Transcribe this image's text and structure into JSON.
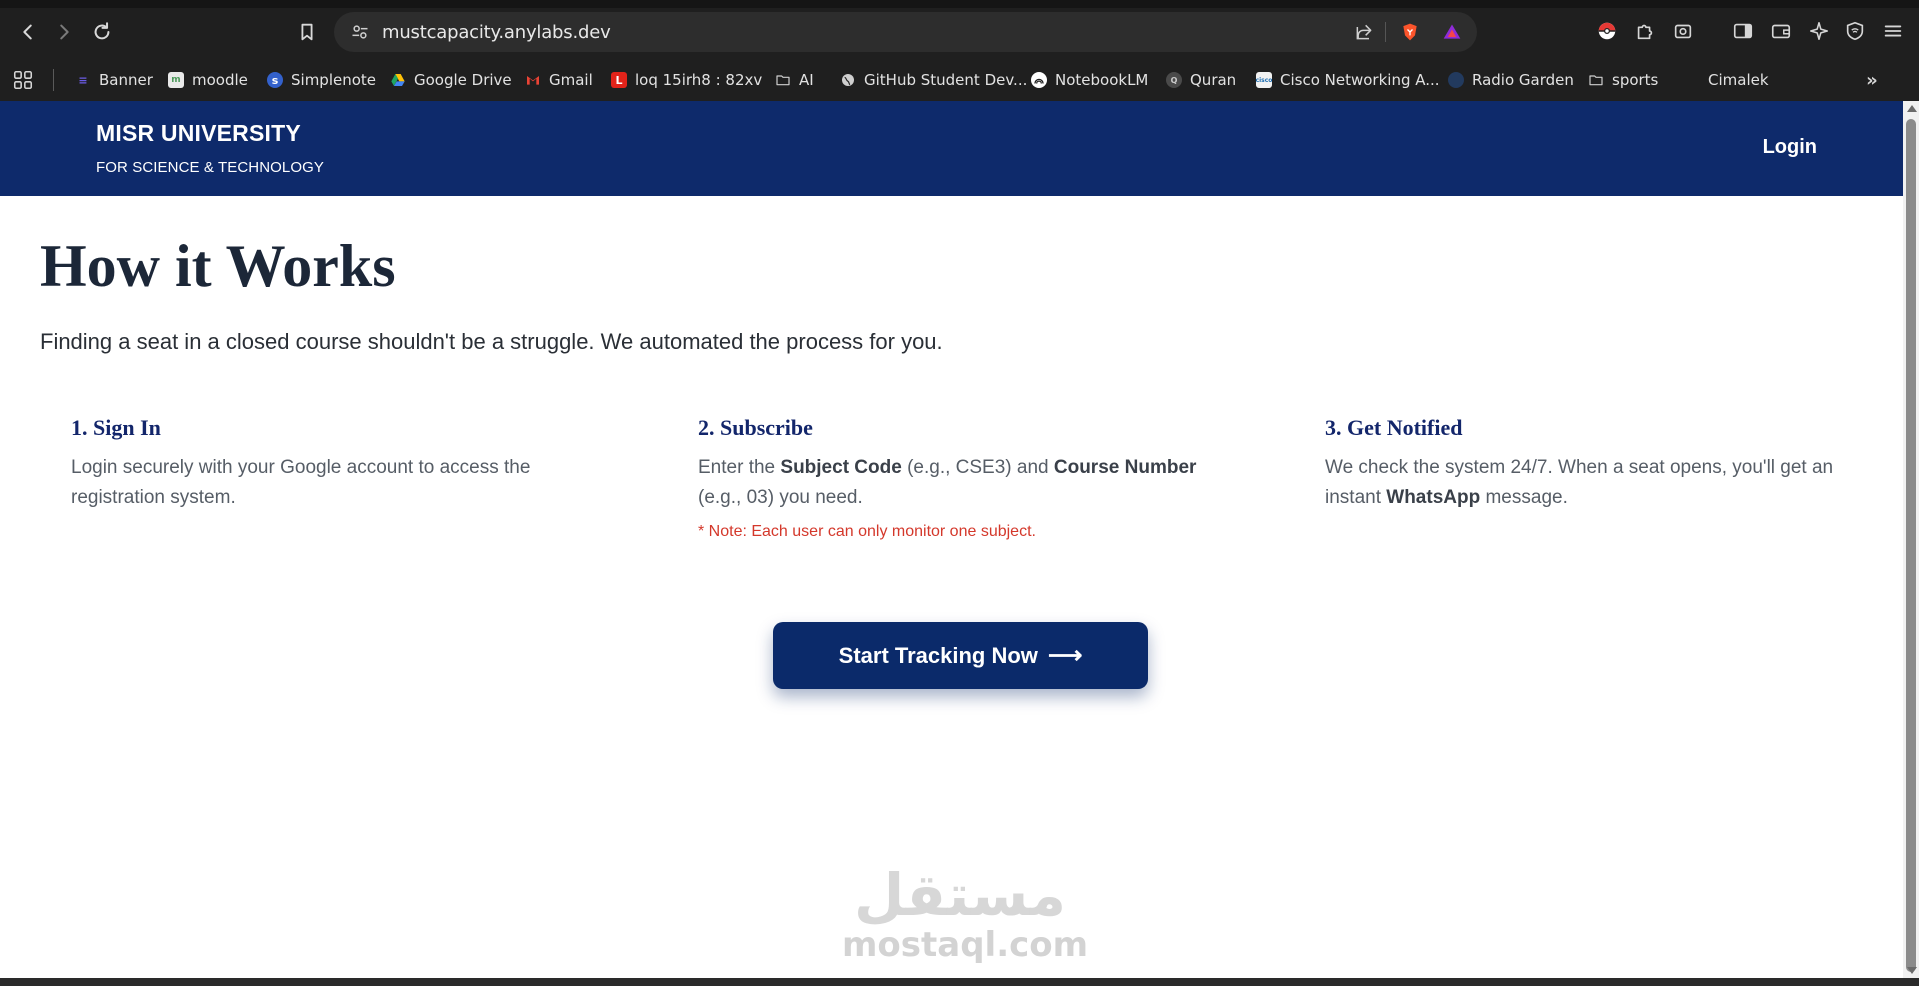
{
  "browser": {
    "url": "mustcapacity.anylabs.dev",
    "bookmarks": [
      {
        "label": "Banner",
        "icon": "banner-icon",
        "color": "#5b4bd6"
      },
      {
        "label": "moodle",
        "icon": "moodle-icon",
        "color": "#4c9a5b"
      },
      {
        "label": "Simplenote",
        "icon": "simplenote-icon",
        "color": "#3361cc"
      },
      {
        "label": "Google Drive",
        "icon": "google-drive-icon",
        "color": "#1fa463"
      },
      {
        "label": "Gmail",
        "icon": "gmail-icon",
        "color": "#ea4335"
      },
      {
        "label": "loq 15irh8 : 82xv",
        "icon": "lenovo-icon",
        "color": "#e2231a"
      },
      {
        "label": "AI",
        "icon": "folder-icon",
        "color": "#cfcfcf"
      },
      {
        "label": "GitHub Student Dev...",
        "icon": "globe-icon",
        "color": "#cfcfcf"
      },
      {
        "label": "NotebookLM",
        "icon": "notebooklm-icon",
        "color": "#ffffff"
      },
      {
        "label": "Quran",
        "icon": "quran-icon",
        "color": "#9a9a9a"
      },
      {
        "label": "Cisco Networking A...",
        "icon": "cisco-icon",
        "color": "#e0e0e0"
      },
      {
        "label": "Radio Garden",
        "icon": "radio-garden-icon",
        "color": "#3a6ea5"
      },
      {
        "label": "sports",
        "icon": "folder-icon",
        "color": "#cfcfcf"
      },
      {
        "label": "Cimalek",
        "icon": "cimalek-icon",
        "color": "#1f1f1f"
      }
    ]
  },
  "header": {
    "brand_title": "MISR UNIVERSITY",
    "brand_subtitle": "FOR SCIENCE & TECHNOLOGY",
    "login_label": "Login",
    "bg_color": "#0e2a6b"
  },
  "main": {
    "title": "How it Works",
    "intro": "Finding a seat in a closed course shouldn't be a struggle. We automated the process for you.",
    "steps": [
      {
        "title": "1. Sign In",
        "text_parts": [
          "Login securely with your Google account to access the registration system."
        ]
      },
      {
        "title": "2. Subscribe",
        "text_parts": [
          "Enter the ",
          "Subject Code",
          " (e.g., CSE3) and ",
          "Course Number",
          " (e.g., 03) you need."
        ],
        "note": "* Note: Each user can only monitor one subject."
      },
      {
        "title": "3. Get Notified",
        "text_parts": [
          "We check the system 24/7. When a seat opens, you'll get an instant ",
          "WhatsApp",
          " message."
        ]
      }
    ],
    "cta_label": "Start Tracking Now",
    "cta_arrow": "⟶"
  },
  "watermark": {
    "logo_text": "مستقل",
    "site": "mostaql.com"
  }
}
